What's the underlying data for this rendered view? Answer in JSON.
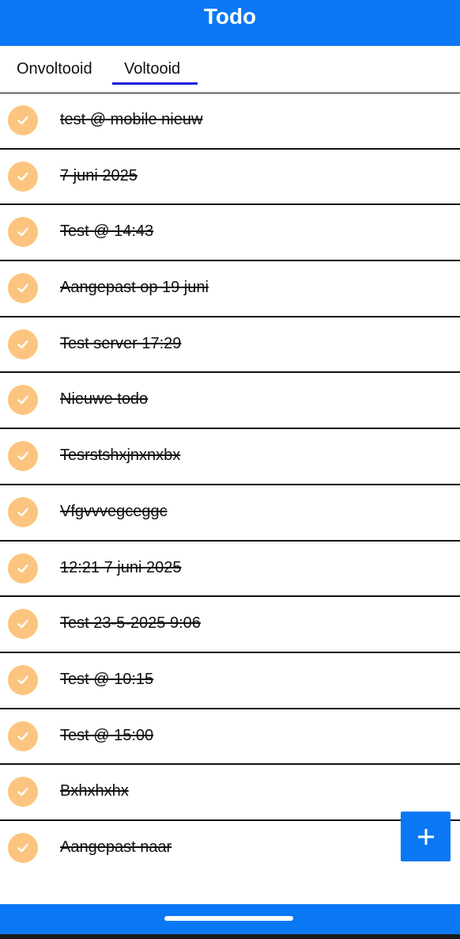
{
  "app": {
    "title": "Todo",
    "accent_color": "#0a78f5",
    "check_color": "#fcc57f"
  },
  "tabs": [
    {
      "label": "Onvoltooid",
      "selected": false
    },
    {
      "label": "Voltooid",
      "selected": true
    }
  ],
  "todos": [
    {
      "text": "test @ mobile nieuw",
      "completed": true
    },
    {
      "text": "7 juni 2025",
      "completed": true
    },
    {
      "text": "Test @ 14:43",
      "completed": true
    },
    {
      "text": "Aangepast op 19 juni",
      "completed": true
    },
    {
      "text": "Test server 17:29",
      "completed": true
    },
    {
      "text": "Nieuwe todo",
      "completed": true
    },
    {
      "text": "Tesrstshxjnxnxbx",
      "completed": true
    },
    {
      "text": "Vfgvvvegceggc",
      "completed": true
    },
    {
      "text": "12:21 7 juni 2025",
      "completed": true
    },
    {
      "text": "Test 23-5-2025 9:06",
      "completed": true
    },
    {
      "text": "Test @ 10:15",
      "completed": true
    },
    {
      "text": "Test @ 15:00",
      "completed": true
    },
    {
      "text": "Bxhxhxhx",
      "completed": true
    },
    {
      "text": "Aangepast naar",
      "completed": true
    }
  ],
  "fab": {
    "icon": "plus-icon"
  }
}
